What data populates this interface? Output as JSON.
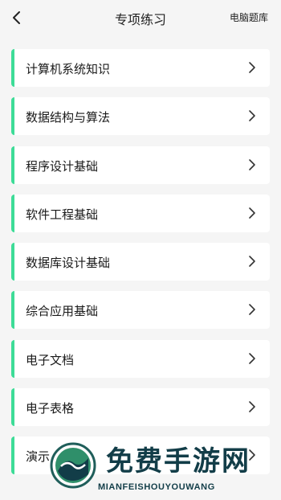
{
  "header": {
    "title": "专项练习",
    "right_link": "电脑题库",
    "back_icon": "chevron-left-icon"
  },
  "items": [
    {
      "label": "计算机系统知识"
    },
    {
      "label": "数据结构与算法"
    },
    {
      "label": "程序设计基础"
    },
    {
      "label": "软件工程基础"
    },
    {
      "label": "数据库设计基础"
    },
    {
      "label": "综合应用基础"
    },
    {
      "label": "电子文档"
    },
    {
      "label": "电子表格"
    },
    {
      "label": "演示"
    }
  ],
  "watermark": {
    "title": "免费手游网",
    "subtitle": "MIANFEISHOUYOUWANG"
  },
  "colors": {
    "accent": "#3ddc97",
    "background": "#f5f5f5",
    "card": "#ffffff",
    "watermark": "#123d48"
  }
}
